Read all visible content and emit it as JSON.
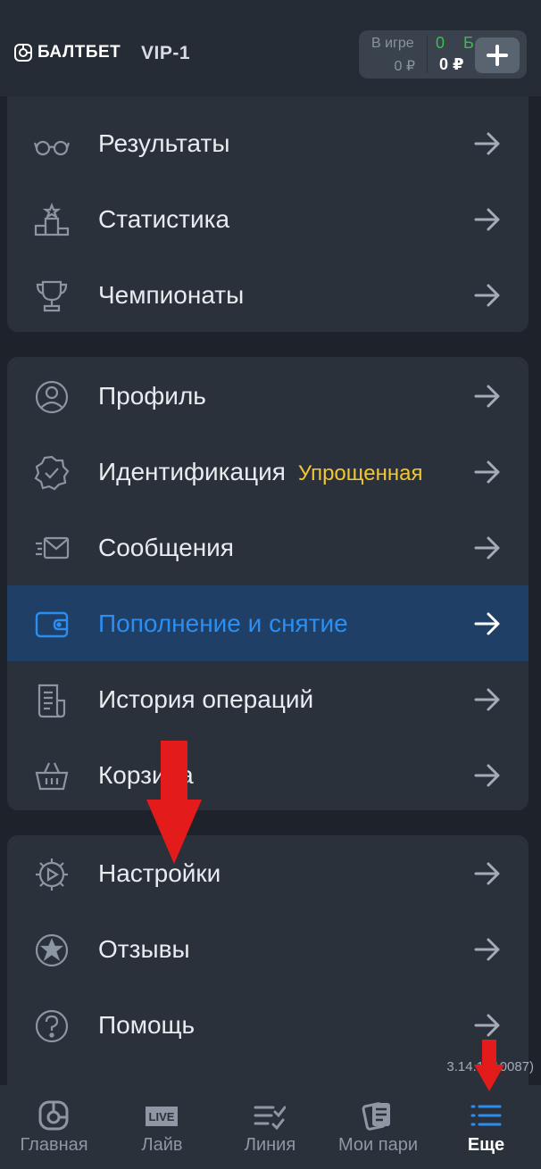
{
  "header": {
    "brand": "БАЛТБЕТ",
    "vip_level": "VIP-1",
    "balance": {
      "in_play_label": "В игре",
      "in_play_value": "0 ₽",
      "bonus": "0 Б",
      "main": "0 ₽"
    }
  },
  "menu": {
    "group1": [
      {
        "label": "Результаты",
        "icon": "glasses-icon"
      },
      {
        "label": "Статистика",
        "icon": "podium-icon"
      },
      {
        "label": "Чемпионаты",
        "icon": "trophy-icon"
      }
    ],
    "group2": [
      {
        "label": "Профиль",
        "icon": "user-icon"
      },
      {
        "label": "Идентификация",
        "badge": "Упрощенная",
        "icon": "badge-check-icon"
      },
      {
        "label": "Сообщения",
        "icon": "envelope-icon"
      },
      {
        "label": "Пополнение и снятие",
        "icon": "wallet-icon",
        "active": true
      },
      {
        "label": "История операций",
        "icon": "receipt-icon"
      },
      {
        "label": "Корзина",
        "icon": "basket-icon"
      }
    ],
    "group3": [
      {
        "label": "Настройки",
        "icon": "settings-gear-icon"
      },
      {
        "label": "Отзывы",
        "icon": "star-circle-icon"
      },
      {
        "label": "Помощь",
        "icon": "help-circle-icon"
      }
    ]
  },
  "version": "3.14.1 (10087)",
  "tabbar": [
    {
      "label": "Главная",
      "icon": "home-ball-icon"
    },
    {
      "label": "Лайв",
      "icon": "live-icon",
      "icon_text": "LIVE"
    },
    {
      "label": "Линия",
      "icon": "list-check-icon"
    },
    {
      "label": "Мои пари",
      "icon": "tickets-icon"
    },
    {
      "label": "Еще",
      "icon": "menu-list-icon",
      "active": true
    }
  ],
  "colors": {
    "accent": "#2b8ef0",
    "badge": "#f2c532",
    "bonus": "#3dbb55",
    "annotation_arrow": "#e31b1b"
  }
}
